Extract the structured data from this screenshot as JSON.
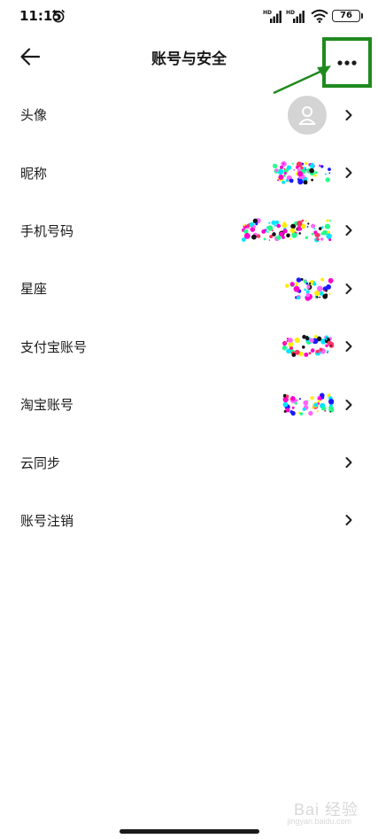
{
  "status_bar": {
    "time": "11:15",
    "battery": "76",
    "signal_1_tag": "HD",
    "signal_2_tag": "HD"
  },
  "header": {
    "title": "账号与安全"
  },
  "rows": [
    {
      "label": "头像"
    },
    {
      "label": "昵称"
    },
    {
      "label": "手机号码"
    },
    {
      "label": "星座"
    },
    {
      "label": "支付宝账号"
    },
    {
      "label": "淘宝账号"
    },
    {
      "label": "云同步"
    },
    {
      "label": "账号注销"
    }
  ],
  "watermark": {
    "text": "Bai 经验",
    "url": "jingyan.baidu.com"
  },
  "colors": {
    "annotation": "#1f8a1f",
    "avatar_bg": "#d4d4d4",
    "text": "#1a1a1a"
  }
}
